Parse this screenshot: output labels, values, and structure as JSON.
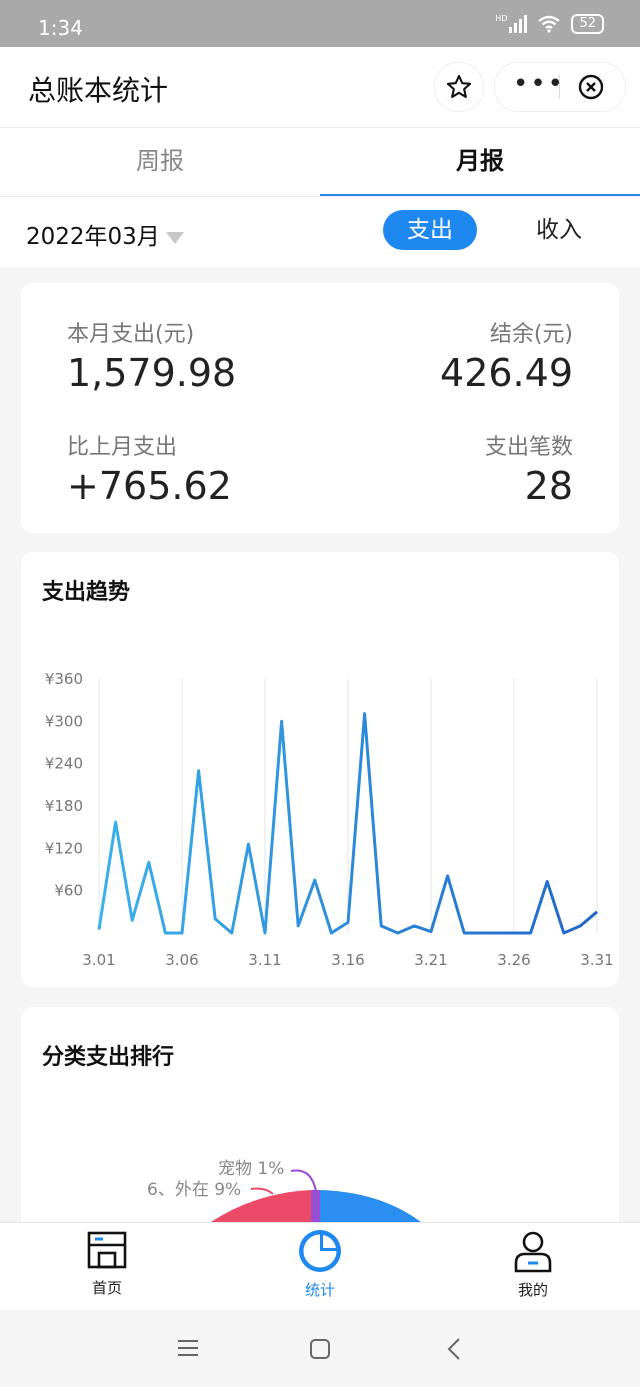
{
  "status": {
    "time": "1:34",
    "battery": "52",
    "network": "HD"
  },
  "appbar": {
    "title": "总账本统计",
    "more": "•••"
  },
  "tabs": [
    {
      "label": "周报"
    },
    {
      "label": "月报"
    }
  ],
  "filter": {
    "month": "2022年03月",
    "expense_label": "支出",
    "income_label": "收入"
  },
  "summary": {
    "month_expense_label": "本月支出(元)",
    "month_expense_value": "1,579.98",
    "balance_label": "结余(元)",
    "balance_value": "426.49",
    "vs_last_label": "比上月支出",
    "vs_last_value": "+765.62",
    "count_label": "支出笔数",
    "count_value": "28"
  },
  "trend": {
    "title": "支出趋势"
  },
  "ranking": {
    "title": "分类支出排行",
    "label_pet": "宠物 1%",
    "label_out": "6、外在 9%"
  },
  "nav": [
    {
      "label": "首页"
    },
    {
      "label": "统计"
    },
    {
      "label": "我的"
    }
  ],
  "colors": {
    "accent": "#1e88f0",
    "pie_red": "#ec4a67",
    "pie_blue": "#2a8ff0",
    "pie_purple": "#9b4ed4"
  },
  "chart_data": {
    "type": "line",
    "title": "支出趋势",
    "ylim": [
      0,
      360
    ],
    "yticks": [
      "¥360",
      "¥300",
      "¥240",
      "¥180",
      "¥120",
      "¥60"
    ],
    "ytick_values": [
      360,
      300,
      240,
      180,
      120,
      60
    ],
    "xtick_labels": [
      "3.01",
      "3.06",
      "3.11",
      "3.16",
      "3.21",
      "3.26",
      "3.31"
    ],
    "x": [
      "3.01",
      "3.02",
      "3.03",
      "3.04",
      "3.05",
      "3.06",
      "3.07",
      "3.08",
      "3.09",
      "3.10",
      "3.11",
      "3.12",
      "3.13",
      "3.14",
      "3.15",
      "3.16",
      "3.17",
      "3.18",
      "3.19",
      "3.20",
      "3.21",
      "3.22",
      "3.23",
      "3.24",
      "3.25",
      "3.26",
      "3.27",
      "3.28",
      "3.29",
      "3.30",
      "3.31"
    ],
    "values": [
      5,
      157,
      18,
      100,
      0,
      0,
      230,
      20,
      0,
      126,
      0,
      300,
      10,
      75,
      0,
      15,
      311,
      10,
      0,
      10,
      2,
      81,
      0,
      0,
      0,
      0,
      0,
      73,
      0,
      10,
      30
    ]
  }
}
